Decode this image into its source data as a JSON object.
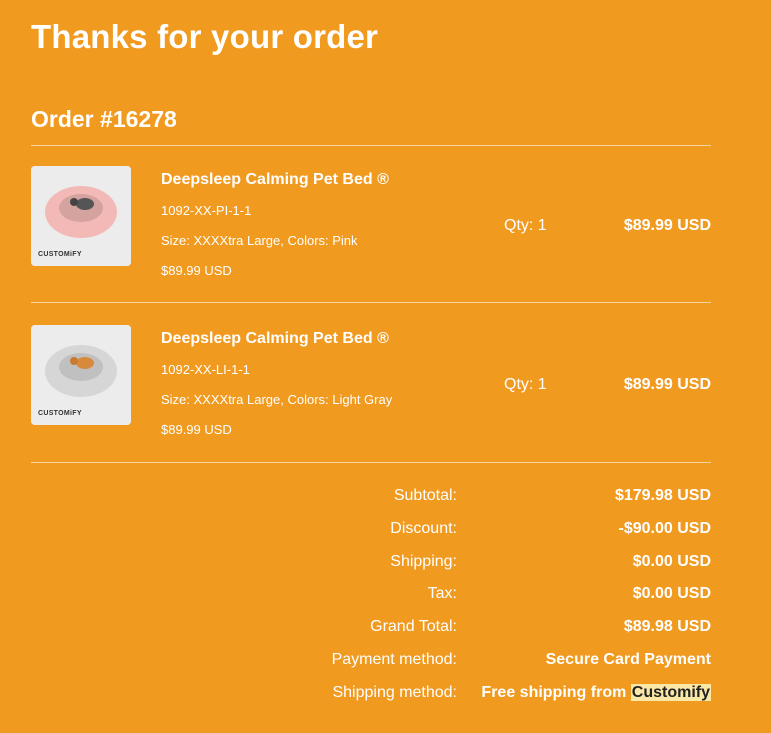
{
  "header": {
    "title": "Thanks for your order"
  },
  "order": {
    "number_label": "Order #16278"
  },
  "items": [
    {
      "name": "Deepsleep Calming Pet Bed ®",
      "sku": "1092-XX-PI-1-1",
      "variant": "Size: XXXXtra Large, Colors: Pink",
      "unit_price": "$89.99 USD",
      "qty": "Qty: 1",
      "line_total": "$89.99 USD",
      "thumb_brand": "CUSTOMiFY",
      "bed_color": "#f2b9b6"
    },
    {
      "name": "Deepsleep Calming Pet Bed ®",
      "sku": "1092-XX-LI-1-1",
      "variant": "Size: XXXXtra Large, Colors: Light Gray",
      "unit_price": "$89.99 USD",
      "qty": "Qty: 1",
      "line_total": "$89.99 USD",
      "thumb_brand": "CUSTOMiFY",
      "bed_color": "#d6d6d6"
    }
  ],
  "totals": {
    "subtotal_label": "Subtotal:",
    "subtotal": "$179.98 USD",
    "discount_label": "Discount:",
    "discount": "-$90.00 USD",
    "shipping_label": "Shipping:",
    "shipping": "$0.00 USD",
    "tax_label": "Tax:",
    "tax": "$0.00 USD",
    "grand_label": "Grand Total:",
    "grand": "$89.98 USD",
    "payment_label": "Payment method:",
    "payment": "Secure Card Payment",
    "shipmethod_label": "Shipping method:",
    "shipmethod_prefix": "Free shipping from ",
    "shipmethod_highlight": "Customify"
  },
  "colors": {
    "background": "#F19A20",
    "text": "#ffffff",
    "highlight": "#fbe7a6"
  }
}
